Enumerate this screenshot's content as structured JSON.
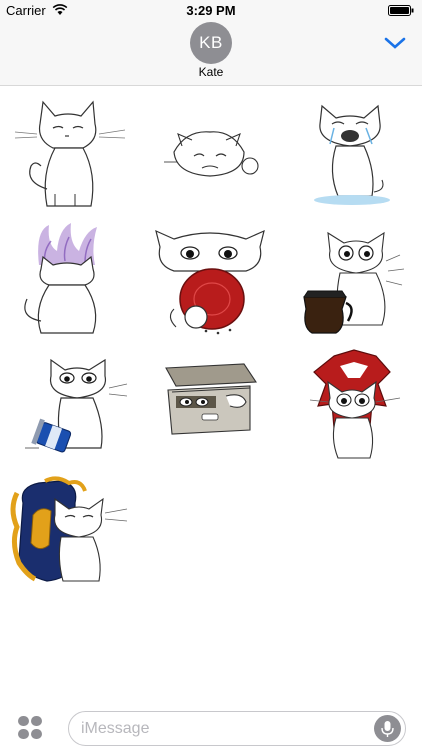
{
  "status_bar": {
    "carrier": "Carrier",
    "time": "3:29 PM"
  },
  "header": {
    "avatar_initials": "KB",
    "contact_name": "Kate"
  },
  "stickers": [
    {
      "name": "cat-sitting"
    },
    {
      "name": "cat-lying-with-ball"
    },
    {
      "name": "cat-crying"
    },
    {
      "name": "cat-back-purple-aura"
    },
    {
      "name": "cat-with-red-plate"
    },
    {
      "name": "cat-with-coffee-pot"
    },
    {
      "name": "cat-with-jar"
    },
    {
      "name": "cat-in-box"
    },
    {
      "name": "cat-horde-emblem"
    },
    {
      "name": "cat-alliance-emblem"
    }
  ],
  "input": {
    "placeholder": "iMessage"
  },
  "colors": {
    "accent": "#1a73e8",
    "avatar": "#8e8e93",
    "horde_red": "#b81c1c",
    "alliance_blue": "#1a2e6e",
    "alliance_gold": "#e2a11a"
  }
}
